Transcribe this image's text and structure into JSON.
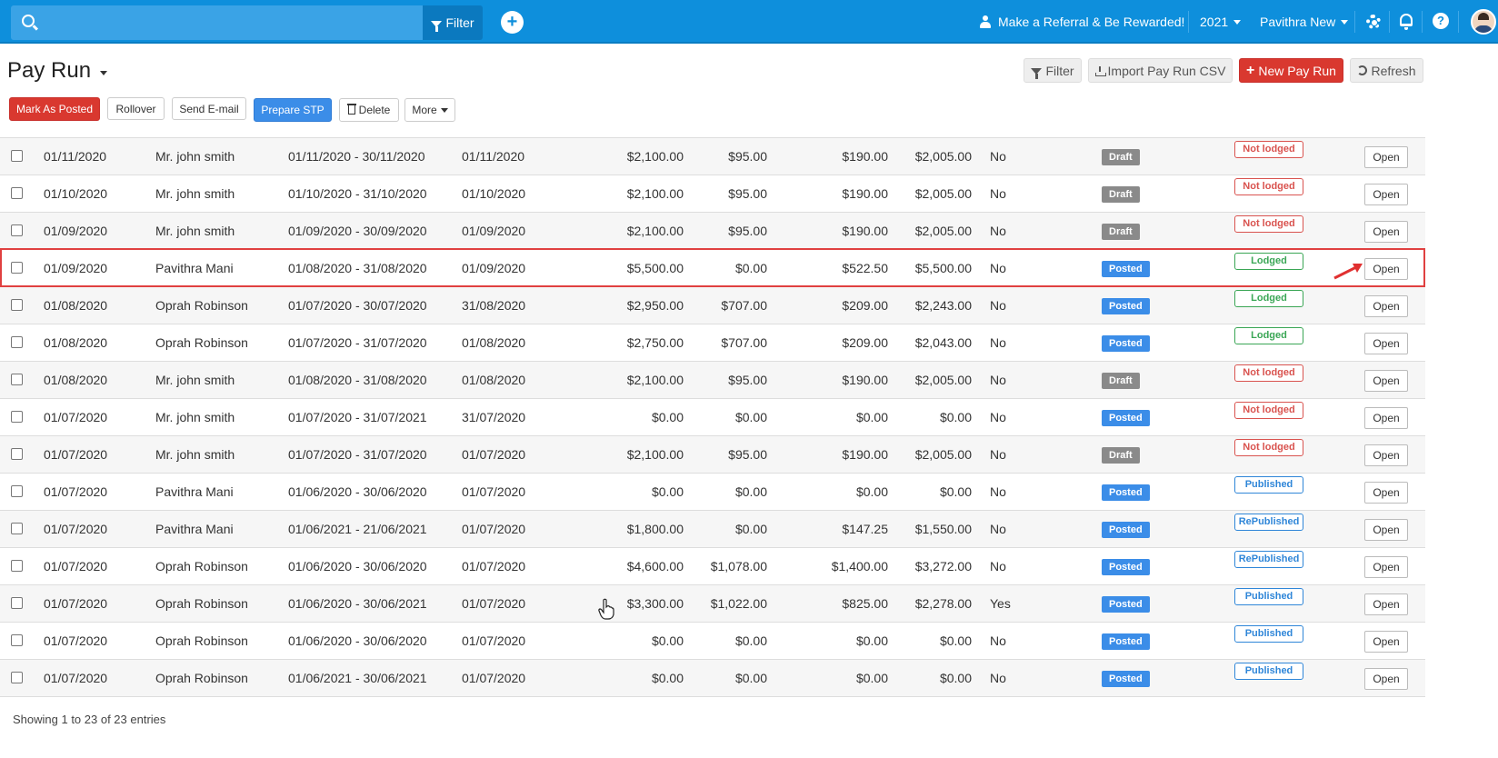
{
  "topbar": {
    "search_placeholder": "",
    "filter_label": "Filter",
    "referral_label": "Make a Referral & Be Rewarded!",
    "year_label": "2021",
    "user_label": "Pavithra New",
    "help_glyph": "?",
    "plus_glyph": "+"
  },
  "page": {
    "title": "Pay Run"
  },
  "header_actions": {
    "filter_label": "Filter",
    "import_label": "Import Pay Run CSV",
    "new_label": "New Pay Run",
    "refresh_label": "Refresh"
  },
  "toolbar": {
    "mark_posted": "Mark As Posted",
    "rollover": "Rollover",
    "send_email": "Send E-mail",
    "prepare_stp": "Prepare STP",
    "delete": "Delete",
    "more": "More"
  },
  "rows": [
    {
      "date": "01/11/2020",
      "name": "Mr. john smith",
      "period": "01/11/2020 - 30/11/2020",
      "pay_date": "01/11/2020",
      "gross": "$2,100.00",
      "tax": "$95.00",
      "super": "$190.00",
      "net": "$2,005.00",
      "flag": "No",
      "status": "Draft",
      "lodgement": "Not lodged",
      "action": "Open"
    },
    {
      "date": "01/10/2020",
      "name": "Mr. john smith",
      "period": "01/10/2020 - 31/10/2020",
      "pay_date": "01/10/2020",
      "gross": "$2,100.00",
      "tax": "$95.00",
      "super": "$190.00",
      "net": "$2,005.00",
      "flag": "No",
      "status": "Draft",
      "lodgement": "Not lodged",
      "action": "Open"
    },
    {
      "date": "01/09/2020",
      "name": "Mr. john smith",
      "period": "01/09/2020 - 30/09/2020",
      "pay_date": "01/09/2020",
      "gross": "$2,100.00",
      "tax": "$95.00",
      "super": "$190.00",
      "net": "$2,005.00",
      "flag": "No",
      "status": "Draft",
      "lodgement": "Not lodged",
      "action": "Open"
    },
    {
      "date": "01/09/2020",
      "name": "Pavithra Mani",
      "period": "01/08/2020 - 31/08/2020",
      "pay_date": "01/09/2020",
      "gross": "$5,500.00",
      "tax": "$0.00",
      "super": "$522.50",
      "net": "$5,500.00",
      "flag": "No",
      "status": "Posted",
      "lodgement": "Lodged",
      "action": "Open"
    },
    {
      "date": "01/08/2020",
      "name": "Oprah Robinson",
      "period": "01/07/2020 - 30/07/2020",
      "pay_date": "31/08/2020",
      "gross": "$2,950.00",
      "tax": "$707.00",
      "super": "$209.00",
      "net": "$2,243.00",
      "flag": "No",
      "status": "Posted",
      "lodgement": "Lodged",
      "action": "Open"
    },
    {
      "date": "01/08/2020",
      "name": "Oprah Robinson",
      "period": "01/07/2020 - 31/07/2020",
      "pay_date": "01/08/2020",
      "gross": "$2,750.00",
      "tax": "$707.00",
      "super": "$209.00",
      "net": "$2,043.00",
      "flag": "No",
      "status": "Posted",
      "lodgement": "Lodged",
      "action": "Open"
    },
    {
      "date": "01/08/2020",
      "name": "Mr. john smith",
      "period": "01/08/2020 - 31/08/2020",
      "pay_date": "01/08/2020",
      "gross": "$2,100.00",
      "tax": "$95.00",
      "super": "$190.00",
      "net": "$2,005.00",
      "flag": "No",
      "status": "Draft",
      "lodgement": "Not lodged",
      "action": "Open"
    },
    {
      "date": "01/07/2020",
      "name": "Mr. john smith",
      "period": "01/07/2020 - 31/07/2021",
      "pay_date": "31/07/2020",
      "gross": "$0.00",
      "tax": "$0.00",
      "super": "$0.00",
      "net": "$0.00",
      "flag": "No",
      "status": "Posted",
      "lodgement": "Not lodged",
      "action": "Open"
    },
    {
      "date": "01/07/2020",
      "name": "Mr. john smith",
      "period": "01/07/2020 - 31/07/2020",
      "pay_date": "01/07/2020",
      "gross": "$2,100.00",
      "tax": "$95.00",
      "super": "$190.00",
      "net": "$2,005.00",
      "flag": "No",
      "status": "Draft",
      "lodgement": "Not lodged",
      "action": "Open"
    },
    {
      "date": "01/07/2020",
      "name": "Pavithra Mani",
      "period": "01/06/2020 - 30/06/2020",
      "pay_date": "01/07/2020",
      "gross": "$0.00",
      "tax": "$0.00",
      "super": "$0.00",
      "net": "$0.00",
      "flag": "No",
      "status": "Posted",
      "lodgement": "Published",
      "action": "Open"
    },
    {
      "date": "01/07/2020",
      "name": "Pavithra Mani",
      "period": "01/06/2021 - 21/06/2021",
      "pay_date": "01/07/2020",
      "gross": "$1,800.00",
      "tax": "$0.00",
      "super": "$147.25",
      "net": "$1,550.00",
      "flag": "No",
      "status": "Posted",
      "lodgement": "RePublished",
      "action": "Open"
    },
    {
      "date": "01/07/2020",
      "name": "Oprah Robinson",
      "period": "01/06/2020 - 30/06/2020",
      "pay_date": "01/07/2020",
      "gross": "$4,600.00",
      "tax": "$1,078.00",
      "super": "$1,400.00",
      "net": "$3,272.00",
      "flag": "No",
      "status": "Posted",
      "lodgement": "RePublished",
      "action": "Open"
    },
    {
      "date": "01/07/2020",
      "name": "Oprah Robinson",
      "period": "01/06/2020 - 30/06/2021",
      "pay_date": "01/07/2020",
      "gross": "$3,300.00",
      "tax": "$1,022.00",
      "super": "$825.00",
      "net": "$2,278.00",
      "flag": "Yes",
      "status": "Posted",
      "lodgement": "Published",
      "action": "Open"
    },
    {
      "date": "01/07/2020",
      "name": "Oprah Robinson",
      "period": "01/06/2020 - 30/06/2020",
      "pay_date": "01/07/2020",
      "gross": "$0.00",
      "tax": "$0.00",
      "super": "$0.00",
      "net": "$0.00",
      "flag": "No",
      "status": "Posted",
      "lodgement": "Published",
      "action": "Open"
    },
    {
      "date": "01/07/2020",
      "name": "Oprah Robinson",
      "period": "01/06/2021 - 30/06/2021",
      "pay_date": "01/07/2020",
      "gross": "$0.00",
      "tax": "$0.00",
      "super": "$0.00",
      "net": "$0.00",
      "flag": "No",
      "status": "Posted",
      "lodgement": "Published",
      "action": "Open"
    }
  ],
  "footer": {
    "entries_text": "Showing 1 to 23 of 23 entries"
  },
  "colors": {
    "brand": "#0e8fdc",
    "not_lodged": "#d9534f",
    "lodged": "#3aa655",
    "published": "#2f86d8",
    "draft": "#8a8a8a",
    "posted": "#3b8de8"
  },
  "icons": [
    "search-icon",
    "funnel-icon",
    "plus-circle-icon",
    "person-icon",
    "gear-icon",
    "bell-icon",
    "help-icon",
    "download-icon",
    "refresh-icon",
    "trash-icon",
    "arrow-pointer-icon",
    "hand-cursor-icon"
  ]
}
